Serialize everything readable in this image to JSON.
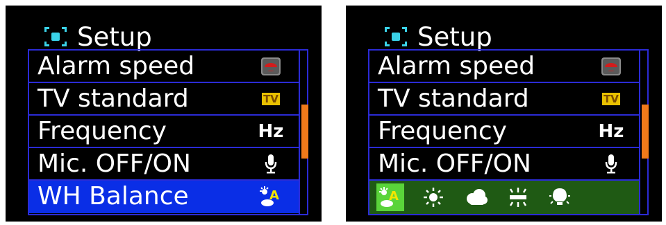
{
  "colors": {
    "screen_bg": "#000000",
    "menu_border": "#2b2bd6",
    "selected_row": "#0a2ee6",
    "scroll_thumb": "#f07a1a",
    "wb_row_bg": "#1f5a14",
    "wb_active_bg": "#5ad43a"
  },
  "left_screen": {
    "header": {
      "title": "Setup",
      "icon": "setup-icon"
    },
    "rows": [
      {
        "label": "Alarm speed",
        "icon": "alarm-speed-icon"
      },
      {
        "label": "TV standard",
        "icon": "tv-standard-icon",
        "icon_text": "TV"
      },
      {
        "label": "Frequency",
        "icon": "hz-icon",
        "icon_text": "Hz"
      },
      {
        "label": "Mic. OFF/ON",
        "icon": "microphone-icon"
      },
      {
        "label": "WH Balance",
        "icon": "white-balance-auto-icon",
        "selected": true
      }
    ],
    "scroll_position": 0.5
  },
  "right_screen": {
    "header": {
      "title": "Setup",
      "icon": "setup-icon"
    },
    "rows": [
      {
        "label": "Alarm speed",
        "icon": "alarm-speed-icon"
      },
      {
        "label": "TV standard",
        "icon": "tv-standard-icon",
        "icon_text": "TV"
      },
      {
        "label": "Frequency",
        "icon": "hz-icon",
        "icon_text": "Hz"
      },
      {
        "label": "Mic. OFF/ON",
        "icon": "microphone-icon"
      }
    ],
    "wb_options": [
      {
        "icon": "white-balance-auto-icon",
        "selected": true
      },
      {
        "icon": "sunny-icon"
      },
      {
        "icon": "cloudy-icon"
      },
      {
        "icon": "fluorescent-icon"
      },
      {
        "icon": "tungsten-icon"
      }
    ],
    "scroll_position": 0.5
  }
}
